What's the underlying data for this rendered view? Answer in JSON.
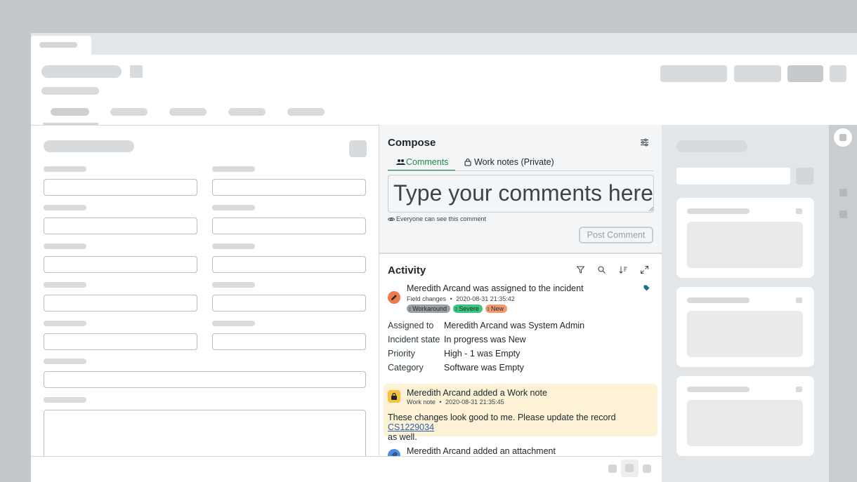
{
  "compose": {
    "title": "Compose",
    "tabs": [
      {
        "label": "Comments",
        "active": true
      },
      {
        "label": "Work notes (Private)",
        "active": false
      }
    ],
    "textarea_text": "Type your comments here",
    "visibility_note": "Everyone can see this comment",
    "post_button": "Post Comment"
  },
  "activity": {
    "title": "Activity",
    "entries": [
      {
        "headline": "Meredith Arcand was assigned to the incident",
        "meta_type": "Field changes",
        "meta_separator": "•",
        "timestamp": "2020-08-31 21:35:42",
        "tags": [
          {
            "label": "Workaround",
            "color": "#9aa1a6"
          },
          {
            "label": "Severe",
            "color": "#3dc47e"
          },
          {
            "label": "New",
            "color": "#f49a72"
          }
        ],
        "fields": [
          {
            "key": "Assigned to",
            "value": "Meredith Arcand was System Admin"
          },
          {
            "key": "Incident state",
            "value": "In progress was New"
          },
          {
            "key": "Priority",
            "value": "High - 1 was Empty"
          },
          {
            "key": "Category",
            "value": "Software was Empty"
          }
        ],
        "avatar_color": "#f07a4a"
      },
      {
        "headline": "Meredith Arcand added a Work note",
        "meta_type": "Work note",
        "meta_separator": "•",
        "timestamp": "2020-08-31 21:35:45",
        "body_text": "These changes look good to me. Please update the record",
        "body_link": "CS1229034",
        "body_tail": "as well.",
        "avatar_color": "#f5c242",
        "highlight_color": "#fdf1d6"
      },
      {
        "headline": "Meredith Arcand added an attachment",
        "avatar_color": "#4a8de0"
      }
    ]
  },
  "colors": {
    "accent_green": "#1f8a4c",
    "link": "#2f5fb3",
    "tag_icon": "#1a6e8e"
  },
  "icons": [
    "users-icon",
    "lock-icon",
    "eye-icon",
    "settings-sliders-icon",
    "filter-icon",
    "search-icon",
    "sort-icon",
    "expand-icon",
    "pencil-icon",
    "lock-icon",
    "paperclip-icon",
    "tag-icon"
  ]
}
